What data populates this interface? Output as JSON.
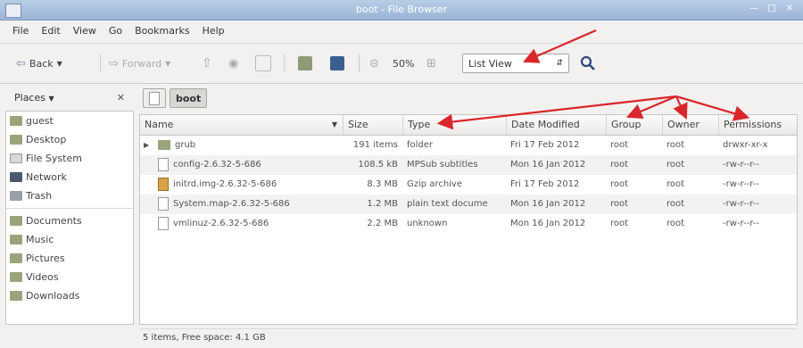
{
  "window": {
    "title": "boot - File Browser"
  },
  "menu": [
    {
      "label": "File"
    },
    {
      "label": "Edit"
    },
    {
      "label": "View"
    },
    {
      "label": "Go"
    },
    {
      "label": "Bookmarks"
    },
    {
      "label": "Help"
    }
  ],
  "toolbar": {
    "back": "Back",
    "forward": "Forward",
    "zoom": "50%",
    "view_mode": "List View"
  },
  "places": {
    "header": "Places",
    "items": [
      {
        "label": "guest",
        "icon": "folder-icon"
      },
      {
        "label": "Desktop",
        "icon": "folder-icon"
      },
      {
        "label": "File System",
        "icon": "drive-icon"
      },
      {
        "label": "Network",
        "icon": "network-icon"
      },
      {
        "label": "Trash",
        "icon": "trash-icon"
      }
    ],
    "bookmarks": [
      {
        "label": "Documents",
        "icon": "folder-icon"
      },
      {
        "label": "Music",
        "icon": "folder-icon"
      },
      {
        "label": "Pictures",
        "icon": "folder-icon"
      },
      {
        "label": "Videos",
        "icon": "folder-icon"
      },
      {
        "label": "Downloads",
        "icon": "folder-icon"
      }
    ]
  },
  "path": {
    "current": "boot"
  },
  "columns": {
    "name": "Name",
    "size": "Size",
    "type": "Type",
    "date": "Date Modified",
    "group": "Group",
    "owner": "Owner",
    "permissions": "Permissions"
  },
  "files": [
    {
      "name": "grub",
      "size": "191 items",
      "type": "folder",
      "date": "Fri 17 Feb 2012",
      "group": "root",
      "owner": "root",
      "permissions": "drwxr-xr-x",
      "icon": "folder-icon"
    },
    {
      "name": "config-2.6.32-5-686",
      "size": "108.5 kB",
      "type": "MPSub subtitles",
      "date": "Mon 16 Jan 2012",
      "group": "root",
      "owner": "root",
      "permissions": "-rw-r--r--",
      "icon": "document-icon"
    },
    {
      "name": "initrd.img-2.6.32-5-686",
      "size": "8.3 MB",
      "type": "Gzip archive",
      "date": "Fri 17 Feb 2012",
      "group": "root",
      "owner": "root",
      "permissions": "-rw-r--r--",
      "icon": "archive-icon"
    },
    {
      "name": "System.map-2.6.32-5-686",
      "size": "1.2 MB",
      "type": "plain text docume",
      "date": "Mon 16 Jan 2012",
      "group": "root",
      "owner": "root",
      "permissions": "-rw-r--r--",
      "icon": "document-icon"
    },
    {
      "name": "vmlinuz-2.6.32-5-686",
      "size": "2.2 MB",
      "type": "unknown",
      "date": "Mon 16 Jan 2012",
      "group": "root",
      "owner": "root",
      "permissions": "-rw-r--r--",
      "icon": "document-icon"
    }
  ],
  "status": "5 items, Free space: 4.1 GB",
  "colors": {
    "annotation_arrow": "#d9262a",
    "folder": "#9aa47a",
    "titlebar": "#a9c0de"
  }
}
